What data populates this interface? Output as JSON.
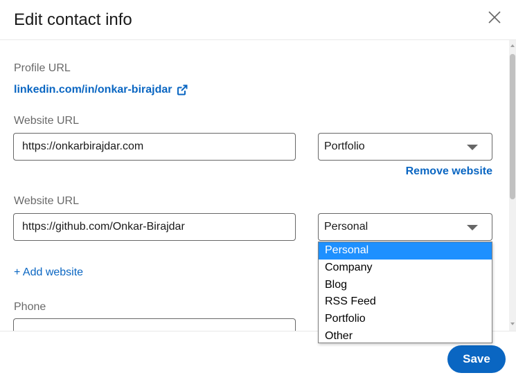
{
  "dialog": {
    "title": "Edit contact info",
    "close_icon": "close-icon"
  },
  "profile": {
    "label": "Profile URL",
    "url": "linkedin.com/in/onkar-birajdar",
    "link_icon": "external-link-icon"
  },
  "websites": [
    {
      "label": "Website URL",
      "url": "https://onkarbirajdar.com",
      "type": "Portfolio",
      "remove_label": "Remove website"
    },
    {
      "label": "Website URL",
      "url": "https://github.com/Onkar-Birajdar",
      "type": "Personal"
    }
  ],
  "add_website_label": "+ Add website",
  "phone": {
    "label": "Phone",
    "value": ""
  },
  "type_dropdown": {
    "options": [
      "Personal",
      "Company",
      "Blog",
      "RSS Feed",
      "Portfolio",
      "Other"
    ],
    "selected": "Personal"
  },
  "footer": {
    "save_label": "Save"
  },
  "colors": {
    "accent": "#0a66c2",
    "highlight": "#1e90ff"
  }
}
